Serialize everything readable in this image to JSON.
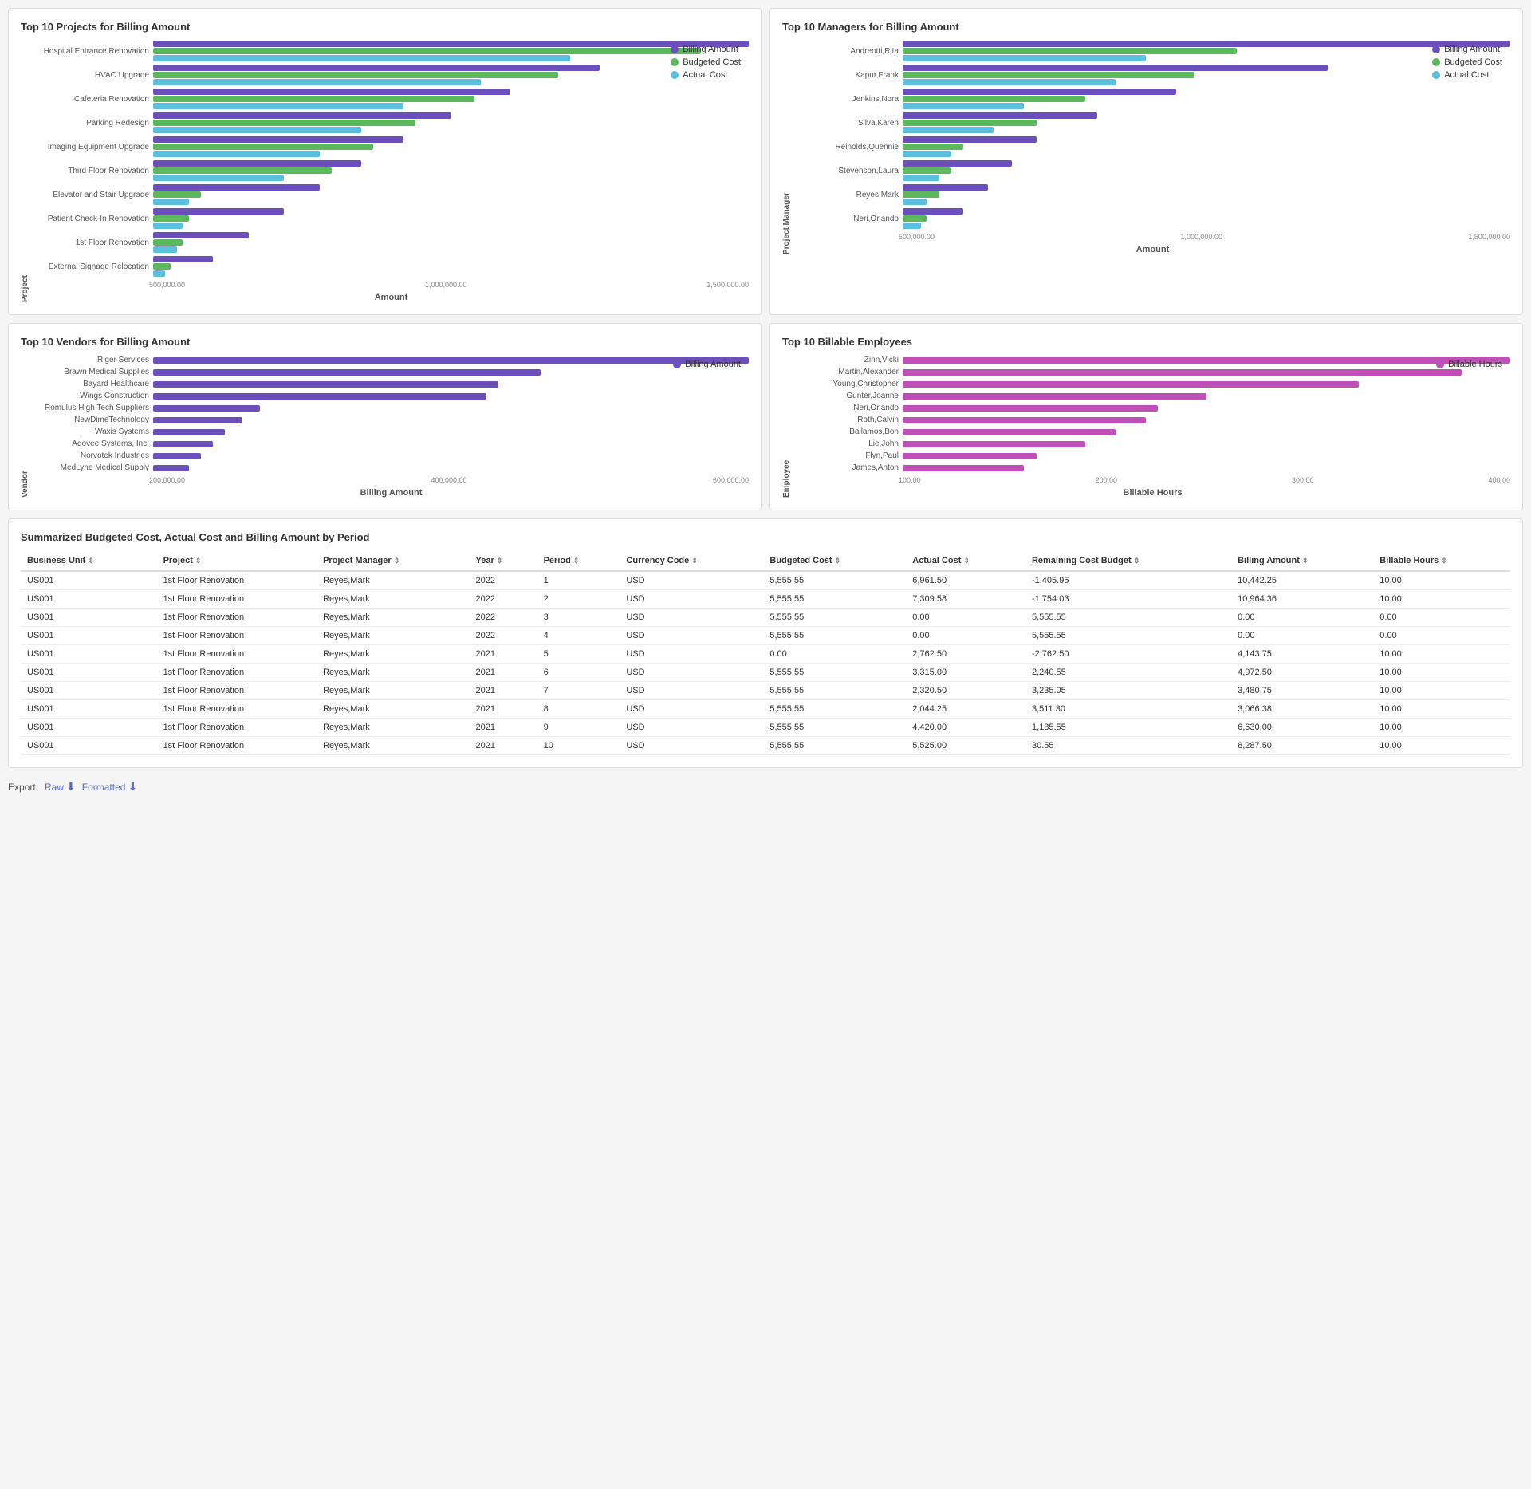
{
  "topProjectsChart": {
    "title": "Top 10 Projects for Billing Amount",
    "legend": [
      "Billing Amount",
      "Budgeted Cost",
      "Actual Cost"
    ],
    "xAxisLabel": "Amount",
    "xAxisTicks": [
      "500,000.00",
      "1,000,000.00",
      "1,500,000.00"
    ],
    "yAxisLabel": "Project",
    "rows": [
      {
        "label": "Hospital Entrance Renovation",
        "billing": 100,
        "budget": 92,
        "actual": 70
      },
      {
        "label": "HVAC Upgrade",
        "billing": 75,
        "budget": 68,
        "actual": 55
      },
      {
        "label": "Cafeteria Renovation",
        "billing": 60,
        "budget": 54,
        "actual": 42
      },
      {
        "label": "Parking Redesign",
        "billing": 50,
        "budget": 44,
        "actual": 35
      },
      {
        "label": "Imaging Equipment Upgrade",
        "billing": 42,
        "budget": 37,
        "actual": 28
      },
      {
        "label": "Third Floor Renovation",
        "billing": 35,
        "budget": 30,
        "actual": 22
      },
      {
        "label": "Elevator and Stair Upgrade",
        "billing": 28,
        "budget": 8,
        "actual": 6
      },
      {
        "label": "Patient Check-In Renovation",
        "billing": 22,
        "budget": 6,
        "actual": 5
      },
      {
        "label": "1st Floor Renovation",
        "billing": 16,
        "budget": 5,
        "actual": 4
      },
      {
        "label": "External Signage Relocation",
        "billing": 10,
        "budget": 3,
        "actual": 2
      }
    ]
  },
  "topManagersChart": {
    "title": "Top 10 Managers for Billing Amount",
    "legend": [
      "Billing Amount",
      "Budgeted Cost",
      "Actual Cost"
    ],
    "xAxisLabel": "Amount",
    "xAxisTicks": [
      "500,000.00",
      "1,000,000.00",
      "1,500,000.00"
    ],
    "yAxisLabel": "Project Manager",
    "rows": [
      {
        "label": "Andreotti,Rita",
        "billing": 100,
        "budget": 55,
        "actual": 40
      },
      {
        "label": "Kapur,Frank",
        "billing": 70,
        "budget": 48,
        "actual": 35
      },
      {
        "label": "Jenkins,Nora",
        "billing": 45,
        "budget": 30,
        "actual": 20
      },
      {
        "label": "Silva,Karen",
        "billing": 32,
        "budget": 22,
        "actual": 15
      },
      {
        "label": "Reinolds,Quennie",
        "billing": 22,
        "budget": 10,
        "actual": 8
      },
      {
        "label": "Stevenson,Laura",
        "billing": 18,
        "budget": 8,
        "actual": 6
      },
      {
        "label": "Reyes,Mark",
        "billing": 14,
        "budget": 6,
        "actual": 4
      },
      {
        "label": "Neri,Orlando",
        "billing": 10,
        "budget": 4,
        "actual": 3
      }
    ]
  },
  "topVendorsChart": {
    "title": "Top 10 Vendors for Billing Amount",
    "legend": [
      "Billing Amount"
    ],
    "xAxisLabel": "Billing Amount",
    "xAxisTicks": [
      "200,000.00",
      "400,000.00",
      "600,000.00"
    ],
    "yAxisLabel": "Vendor",
    "rows": [
      {
        "label": "Riger Services",
        "billing": 100
      },
      {
        "label": "Brawn Medical Supplies",
        "billing": 65
      },
      {
        "label": "Bayard Healthcare",
        "billing": 58
      },
      {
        "label": "Wings Construction",
        "billing": 56
      },
      {
        "label": "Romulus High Tech Suppliers",
        "billing": 18
      },
      {
        "label": "NewDimeTechnology",
        "billing": 15
      },
      {
        "label": "Waxis Systems",
        "billing": 12
      },
      {
        "label": "Adovee Systems, Inc.",
        "billing": 10
      },
      {
        "label": "Norvotek Industries",
        "billing": 8
      },
      {
        "label": "MedLyne Medical Supply",
        "billing": 6
      }
    ]
  },
  "topEmployeesChart": {
    "title": "Top 10 Billable Employees",
    "legend": [
      "Billable Hours"
    ],
    "xAxisLabel": "Billable Hours",
    "xAxisTicks": [
      "100.00",
      "200.00",
      "300.00",
      "400.00"
    ],
    "yAxisLabel": "Employee",
    "rows": [
      {
        "label": "Zinn,Vicki",
        "hours": 100
      },
      {
        "label": "Martin,Alexander",
        "hours": 92
      },
      {
        "label": "Young,Christopher",
        "hours": 75
      },
      {
        "label": "Gunter,Joanne",
        "hours": 50
      },
      {
        "label": "Neri,Orlando",
        "hours": 42
      },
      {
        "label": "Roth,Calvin",
        "hours": 40
      },
      {
        "label": "Ballamos,Bon",
        "hours": 35
      },
      {
        "label": "Lie,John",
        "hours": 30
      },
      {
        "label": "Flyn,Paul",
        "hours": 22
      },
      {
        "label": "James,Anton",
        "hours": 20
      }
    ]
  },
  "summaryTable": {
    "title": "Summarized Budgeted Cost, Actual Cost and Billing Amount by Period",
    "columns": [
      "Business Unit",
      "Project",
      "Project Manager",
      "Year",
      "Period",
      "Currency Code",
      "Budgeted Cost",
      "Actual Cost",
      "Remaining Cost Budget",
      "Billing Amount",
      "Billable Hours"
    ],
    "rows": [
      [
        "US001",
        "1st Floor Renovation",
        "Reyes,Mark",
        "2022",
        "1",
        "USD",
        "5,555.55",
        "6,961.50",
        "-1,405.95",
        "10,442.25",
        "10.00"
      ],
      [
        "US001",
        "1st Floor Renovation",
        "Reyes,Mark",
        "2022",
        "2",
        "USD",
        "5,555.55",
        "7,309.58",
        "-1,754.03",
        "10,964.36",
        "10.00"
      ],
      [
        "US001",
        "1st Floor Renovation",
        "Reyes,Mark",
        "2022",
        "3",
        "USD",
        "5,555.55",
        "0.00",
        "5,555.55",
        "0.00",
        "0.00"
      ],
      [
        "US001",
        "1st Floor Renovation",
        "Reyes,Mark",
        "2022",
        "4",
        "USD",
        "5,555.55",
        "0.00",
        "5,555.55",
        "0.00",
        "0.00"
      ],
      [
        "US001",
        "1st Floor Renovation",
        "Reyes,Mark",
        "2021",
        "5",
        "USD",
        "0.00",
        "2,762.50",
        "-2,762.50",
        "4,143.75",
        "10.00"
      ],
      [
        "US001",
        "1st Floor Renovation",
        "Reyes,Mark",
        "2021",
        "6",
        "USD",
        "5,555.55",
        "3,315.00",
        "2,240.55",
        "4,972.50",
        "10.00"
      ],
      [
        "US001",
        "1st Floor Renovation",
        "Reyes,Mark",
        "2021",
        "7",
        "USD",
        "5,555.55",
        "2,320.50",
        "3,235.05",
        "3,480.75",
        "10.00"
      ],
      [
        "US001",
        "1st Floor Renovation",
        "Reyes,Mark",
        "2021",
        "8",
        "USD",
        "5,555.55",
        "2,044.25",
        "3,511.30",
        "3,066.38",
        "10.00"
      ],
      [
        "US001",
        "1st Floor Renovation",
        "Reyes,Mark",
        "2021",
        "9",
        "USD",
        "5,555.55",
        "4,420.00",
        "1,135.55",
        "6,630.00",
        "10.00"
      ],
      [
        "US001",
        "1st Floor Renovation",
        "Reyes,Mark",
        "2021",
        "10",
        "USD",
        "5,555.55",
        "5,525.00",
        "30.55",
        "8,287.50",
        "10.00"
      ]
    ]
  },
  "export": {
    "label": "Export:",
    "raw_label": "Raw",
    "formatted_label": "Formatted"
  },
  "colors": {
    "billing": "#6b4fbb",
    "budget": "#5cb85c",
    "actual": "#5bc0de",
    "billable": "#c050b8",
    "link": "#5b6bbf"
  }
}
